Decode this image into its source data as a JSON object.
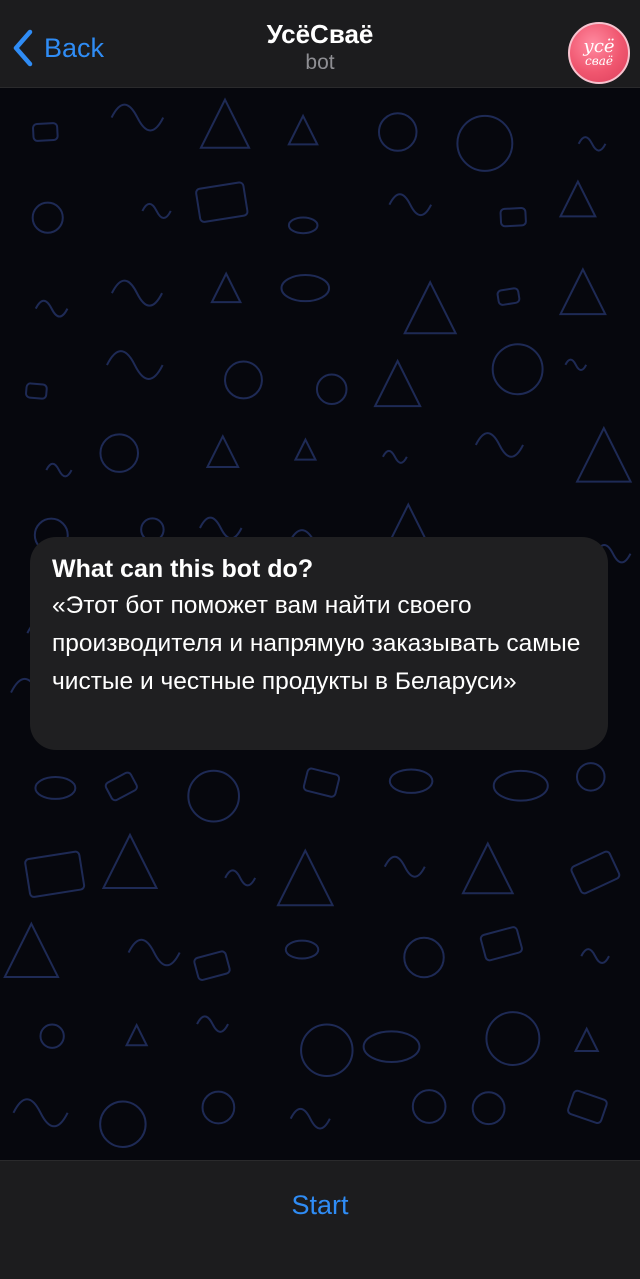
{
  "header": {
    "back_label": "Back",
    "title": "УсёСваё",
    "subtitle": "bot",
    "avatar_line1": "усё",
    "avatar_line2": "сваё"
  },
  "bubble": {
    "title": "What can this bot do?",
    "text": "«Этот бот поможет вам найти своего производителя и напрямую заказывать самые чистые и честные продукты в Беларуси»"
  },
  "footer": {
    "start_label": "Start"
  },
  "colors": {
    "accent": "#2f8cf5",
    "header_bg": "#1c1c1e",
    "bubble_bg": "#1f1f21",
    "wallpaper_bg": "#06070d",
    "doodle": "#1e2a55"
  },
  "icons": {
    "back": "chevron-left-icon",
    "wallpaper": "doodle-pattern"
  }
}
